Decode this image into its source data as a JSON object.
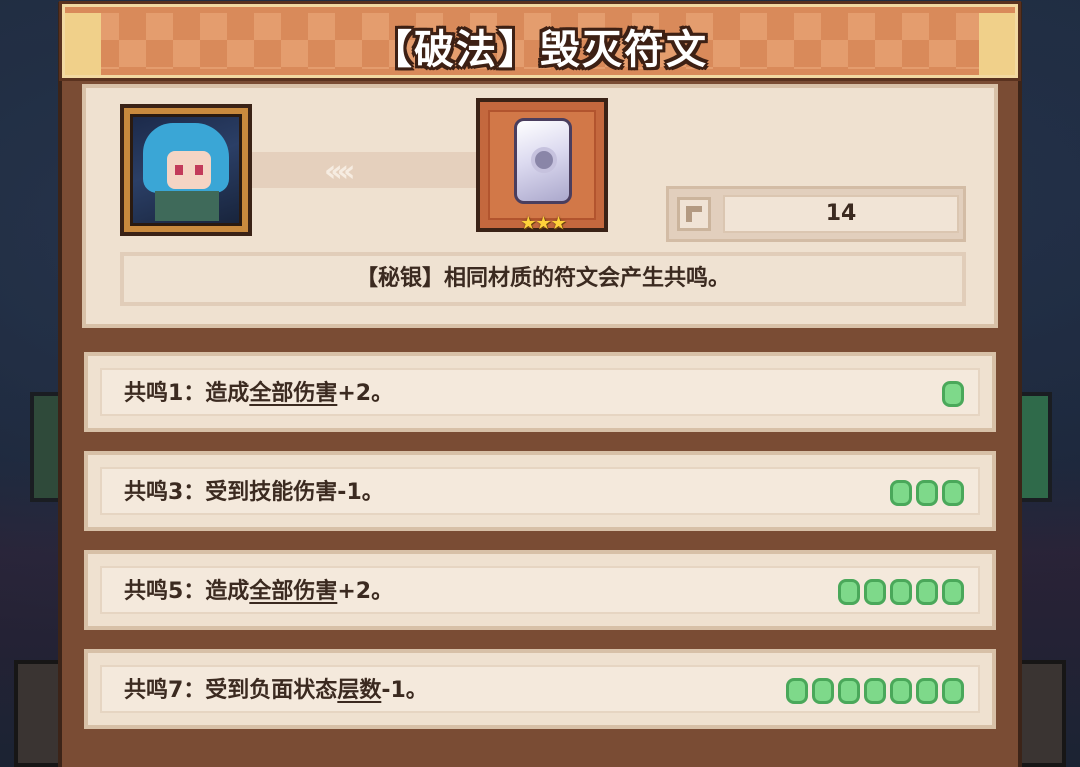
{
  "title": "【破法】毁灭符文",
  "rune": {
    "stars": "★★★",
    "count": "14",
    "description": "【秘银】相同材质的符文会产生共鸣。"
  },
  "link_arrows": "‹‹‹‹",
  "resonances": [
    {
      "prefix": "共鸣1：造成",
      "keyword": "全部伤害",
      "suffix": "+2。",
      "dots": 1
    },
    {
      "prefix": "共鸣3：受到技能伤害-1。",
      "keyword": "",
      "suffix": "",
      "dots": 3
    },
    {
      "prefix": "共鸣5：造成",
      "keyword": "全部伤害",
      "suffix": "+2。",
      "dots": 5
    },
    {
      "prefix": "共鸣7：受到负面状态",
      "keyword": "层数",
      "suffix": "-1。",
      "dots": 7
    }
  ],
  "colors": {
    "panel": "#7a4c34",
    "title_bar": "#d98a5a",
    "card": "#efe1d0",
    "dot_fill": "#7ed98a",
    "dot_border": "#4aa85a",
    "text": "#3b2a20"
  }
}
